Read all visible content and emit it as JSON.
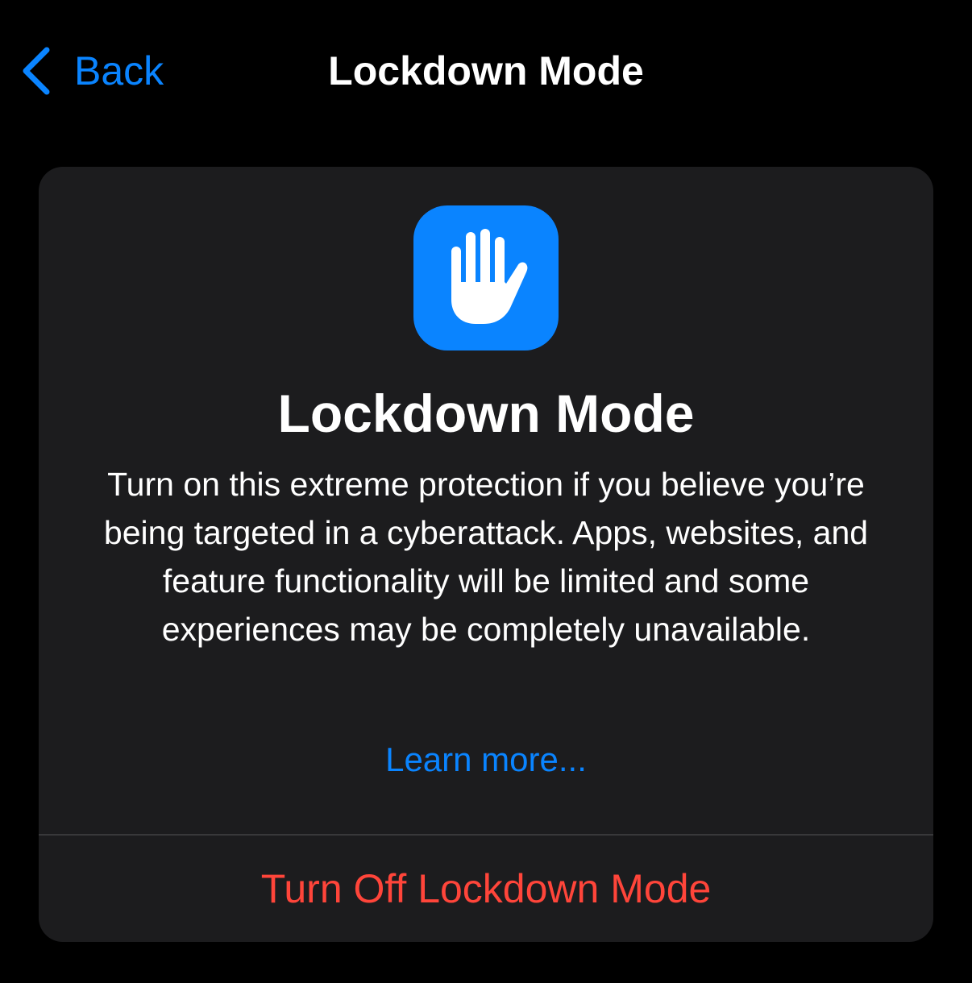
{
  "nav": {
    "back_label": "Back",
    "title": "Lockdown Mode"
  },
  "card": {
    "icon": "hand-raised-icon",
    "title": "Lockdown Mode",
    "description": "Turn on this extreme protection if you believe you’re being targeted in a cyberattack. Apps, websites, and feature functionality will be limited and some experiences may be completely unavailable.",
    "learn_more": "Learn more...",
    "action_label": "Turn Off Lockdown Mode"
  },
  "colors": {
    "background": "#000000",
    "card": "#1c1c1e",
    "accent": "#0a84ff",
    "destructive": "#ff453a",
    "text": "#ffffff"
  }
}
